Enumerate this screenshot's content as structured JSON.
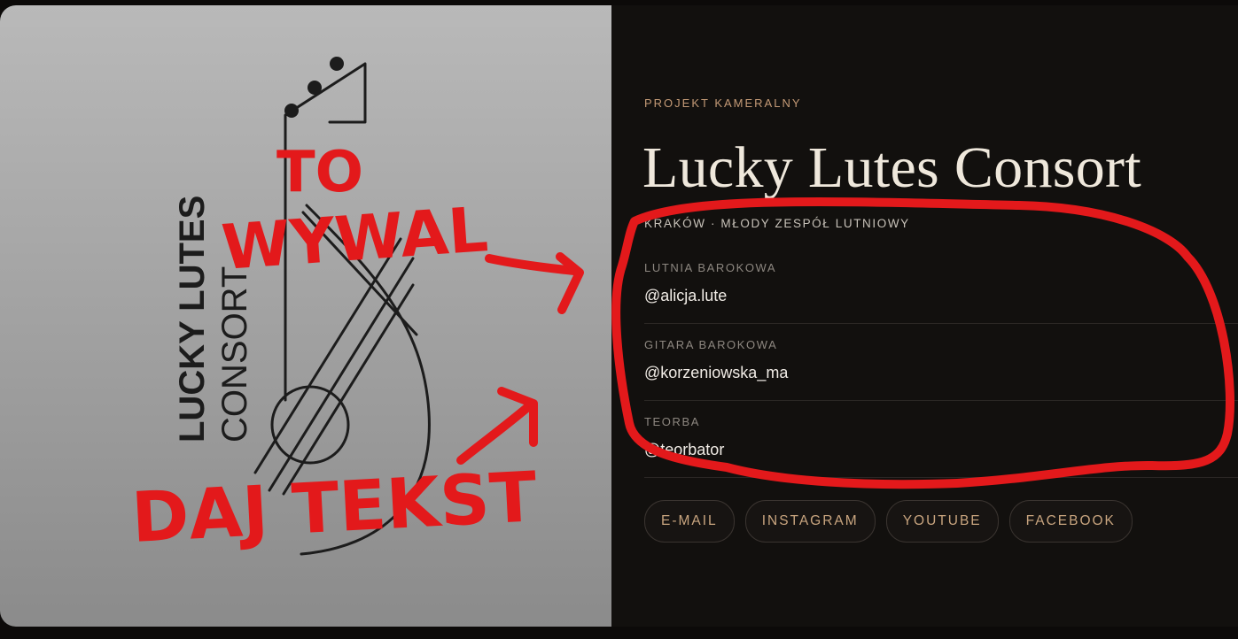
{
  "hero": {
    "logo_text_line1": "LUCKY LUTES",
    "logo_text_line2": "CONSORT"
  },
  "info": {
    "eyebrow": "PROJEKT KAMERALNY",
    "title": "Lucky Lutes Consort",
    "subtitle": "KRAKÓW · MŁODY ZESPÓŁ LUTNIOWY"
  },
  "members": [
    {
      "role": "LUTNIA BAROKOWA",
      "handle": "@alicja.lute"
    },
    {
      "role": "GITARA BAROKOWA",
      "handle": "@korzeniowska_ma"
    },
    {
      "role": "TEORBA",
      "handle": "@teorbator"
    }
  ],
  "links": [
    {
      "label": "E-MAIL"
    },
    {
      "label": "INSTAGRAM"
    },
    {
      "label": "YOUTUBE"
    },
    {
      "label": "FACEBOOK"
    }
  ],
  "annotations": {
    "note_top_line1": "TO",
    "note_top_line2": "WYWAL",
    "note_bottom": "DAJ TEKST"
  },
  "colors": {
    "accent": "#c49a76",
    "annotation_red": "#e3191b",
    "background": "#12100e"
  }
}
